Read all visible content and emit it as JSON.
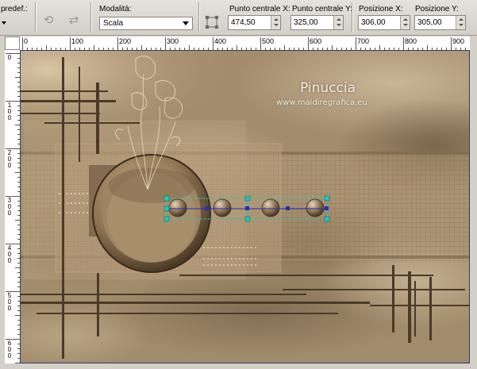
{
  "toolbar": {
    "preset_label": "predef.:",
    "mode_label": "Modalità:",
    "mode_value": "Scala",
    "center_x_label": "Punto centrale X:",
    "center_x_value": "474,50",
    "center_y_label": "Punto centrale Y:",
    "center_y_value": "325,00",
    "pos_x_label": "Posizione X:",
    "pos_x_value": "306,00",
    "pos_y_label": "Posizione Y:",
    "pos_y_value": "305,00"
  },
  "ruler": {
    "h_labels": [
      "0",
      "100",
      "200",
      "300",
      "400",
      "500",
      "600",
      "700",
      "800",
      "900"
    ],
    "v_labels": [
      [
        "0"
      ],
      [
        "1",
        "0",
        "0"
      ],
      [
        "2",
        "0",
        "0"
      ],
      [
        "3",
        "0",
        "0"
      ],
      [
        "4",
        "0",
        "0"
      ],
      [
        "5",
        "0",
        "0"
      ],
      [
        "6",
        "0",
        "0"
      ]
    ]
  },
  "canvas": {
    "watermark_title": "Pinuccia",
    "watermark_url": "www.maidiregrafica.eu"
  },
  "colors": {
    "toolbar_bg": "#d4d0c8",
    "canvas_border": "#2c3f6a",
    "sepia_base": "#a28c6c",
    "sepia_dark": "#4a3a28",
    "selection_handle": "#20c8c0",
    "selection_node": "#2030c0"
  },
  "icons": [
    "dropdown-arrow-icon",
    "rotate-icon",
    "flip-icon",
    "pick-xy-icon",
    "spin-up-icon",
    "spin-down-icon"
  ]
}
